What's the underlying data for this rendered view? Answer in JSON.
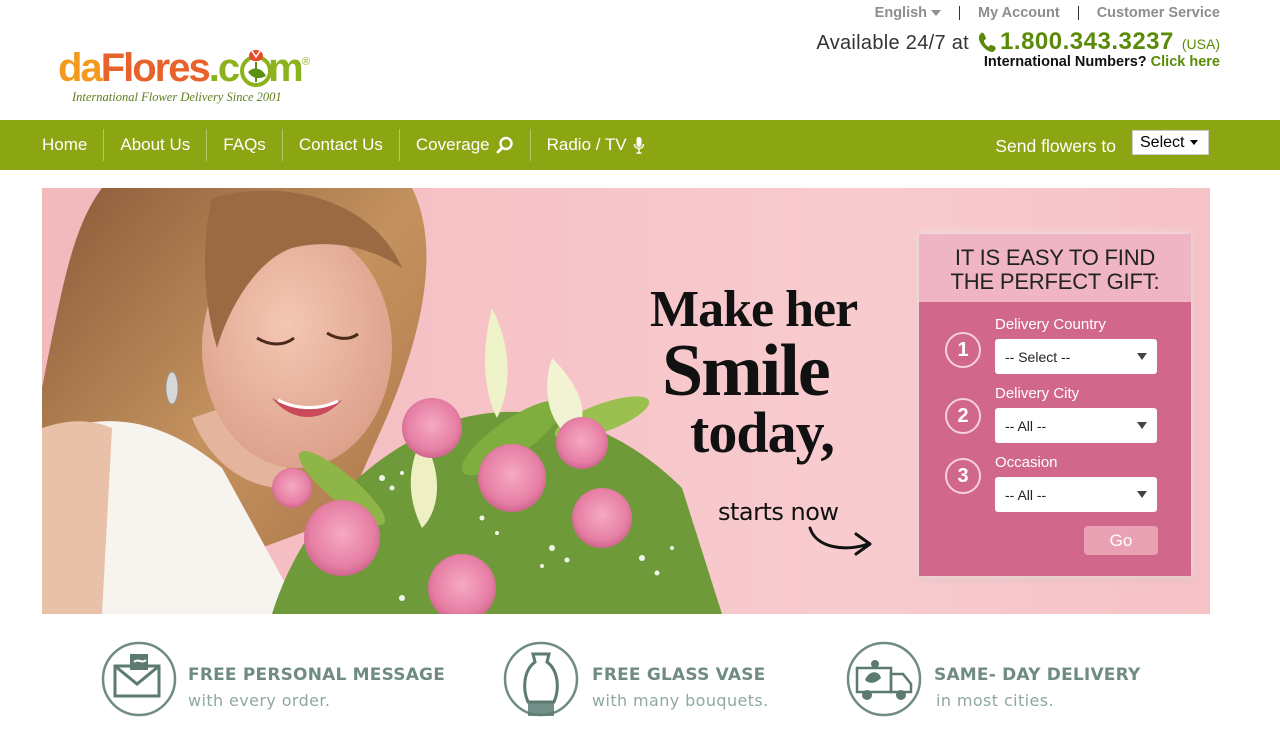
{
  "header": {
    "logo": {
      "da": "da",
      "flores": "Flores",
      "dot": ".c",
      "m": "m",
      "registered": "®",
      "tagline": "International Flower Delivery Since 2001"
    },
    "utility": {
      "language": "English",
      "my_account": "My Account",
      "customer_service": "Customer Service"
    },
    "availability": "Available 24/7 at",
    "phone": "1.800.343.3237",
    "phone_region": "(USA)",
    "international_label": "International Numbers?",
    "international_link": "Click here"
  },
  "nav": {
    "items": [
      {
        "label": "Home",
        "icon": ""
      },
      {
        "label": "About Us",
        "icon": ""
      },
      {
        "label": "FAQs",
        "icon": ""
      },
      {
        "label": "Contact Us",
        "icon": ""
      },
      {
        "label": "Coverage",
        "icon": "search-icon"
      },
      {
        "label": "Radio / TV",
        "icon": "microphone-icon"
      }
    ],
    "send_flowers_label": "Send flowers to",
    "send_flowers_select": "Select"
  },
  "hero": {
    "headline_line1": "Make her",
    "headline_line2": "Smile",
    "headline_line3": "today,",
    "cta": "starts now",
    "finder": {
      "title_line1": "IT IS EASY TO FIND",
      "title_line2": "THE PERFECT GIFT:",
      "steps": [
        {
          "number": "1",
          "label": "Delivery Country",
          "value": "-- Select --"
        },
        {
          "number": "2",
          "label": "Delivery City",
          "value": "-- All --"
        },
        {
          "number": "3",
          "label": "Occasion",
          "value": "-- All --"
        }
      ],
      "go_label": "Go"
    }
  },
  "features": [
    {
      "title": "FREE PERSONAL MESSAGE",
      "subtitle": "with every order.",
      "icon": "envelope-icon"
    },
    {
      "title": "FREE GLASS VASE",
      "subtitle": "with many bouquets.",
      "icon": "vase-icon"
    },
    {
      "title": "SAME- DAY DELIVERY",
      "subtitle": "in most cities.",
      "icon": "delivery-truck-icon"
    }
  ],
  "colors": {
    "brand_green": "#8ba612",
    "phone_green": "#5a8a07",
    "hero_pink": "#f6c3c7",
    "finder_pink": "#d1678a",
    "finder_header": "#efb5c4",
    "feature_teal": "#6f8b84"
  }
}
